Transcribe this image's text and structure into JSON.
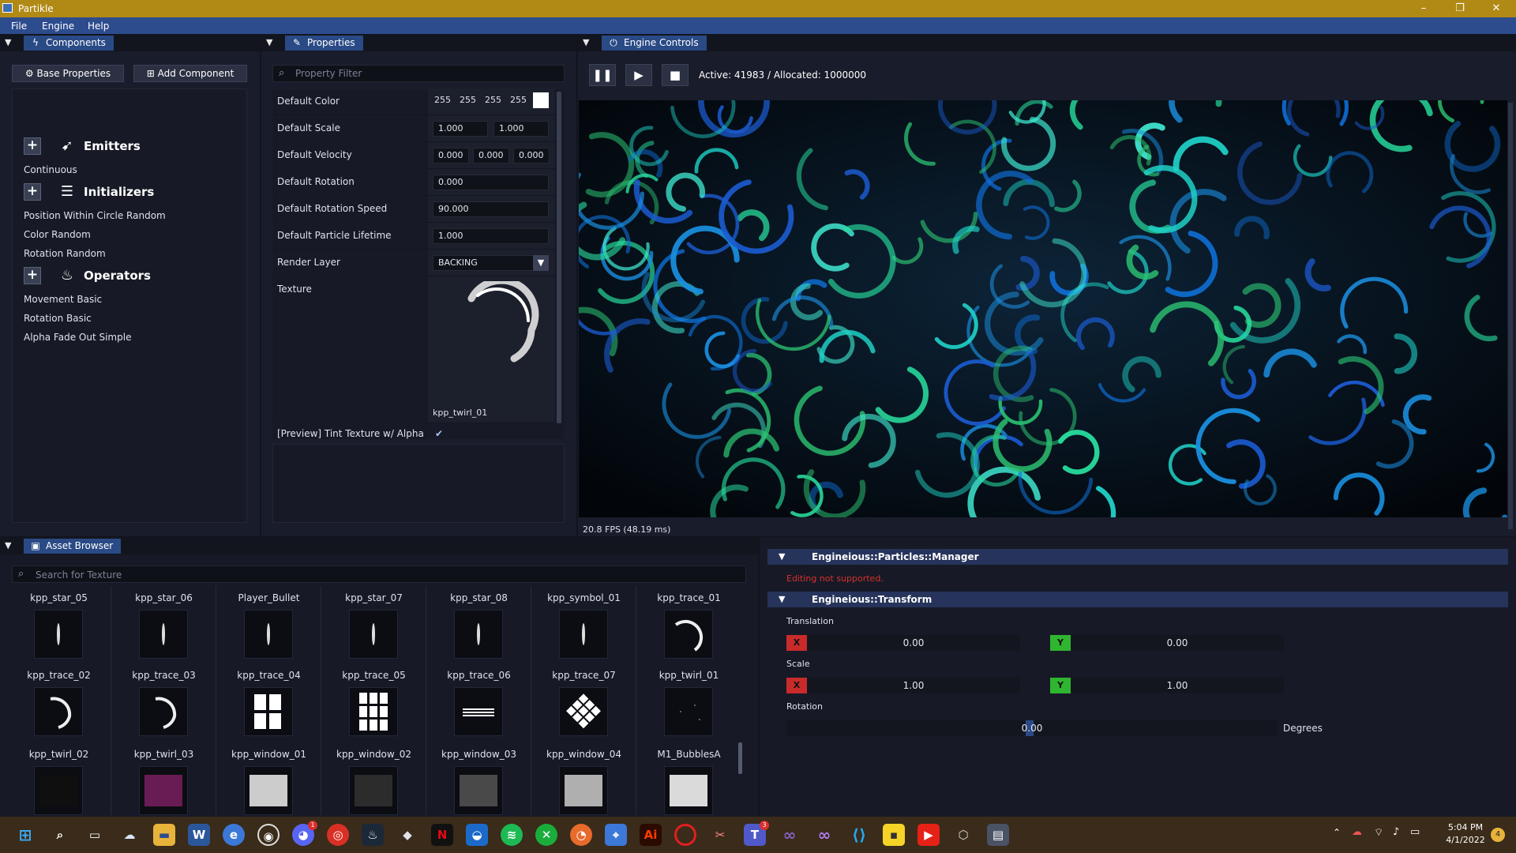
{
  "window": {
    "title": "Partikle",
    "minimize": "–",
    "maximize": "❐",
    "close": "✕"
  },
  "menu": [
    "File",
    "Engine",
    "Help"
  ],
  "components_panel": {
    "tab": "Components",
    "base_properties_button": "Base Properties",
    "add_component_button": "Add Component",
    "emitters": {
      "title": "Emitters",
      "items": [
        "Continuous"
      ]
    },
    "initializers": {
      "title": "Initializers",
      "items": [
        "Position Within Circle Random",
        "Color Random",
        "Rotation Random"
      ]
    },
    "operators": {
      "title": "Operators",
      "items": [
        "Movement Basic",
        "Rotation Basic",
        "Alpha Fade Out Simple"
      ]
    }
  },
  "properties_panel": {
    "tab": "Properties",
    "filter_placeholder": "Property Filter",
    "default_color": {
      "label": "Default Color",
      "r": "255",
      "g": "255",
      "b": "255",
      "a": "255",
      "swatch": "#ffffff"
    },
    "default_scale": {
      "label": "Default Scale",
      "x": "1.000",
      "y": "1.000"
    },
    "default_velocity": {
      "label": "Default Velocity",
      "x": "0.000",
      "y": "0.000",
      "z": "0.000"
    },
    "default_rotation": {
      "label": "Default Rotation",
      "value": "0.000"
    },
    "default_rotation_speed": {
      "label": "Default Rotation Speed",
      "value": "90.000"
    },
    "default_particle_lifetime": {
      "label": "Default Particle Lifetime",
      "value": "1.000"
    },
    "render_layer": {
      "label": "Render Layer",
      "value": "BACKING"
    },
    "texture": {
      "label": "Texture",
      "name": "kpp_twirl_01"
    },
    "tint_preview": {
      "label": "[Preview] Tint Texture w/ Alpha",
      "checked": true
    }
  },
  "engine_panel": {
    "tab": "Engine Controls",
    "status": "Active: 41983 / Allocated: 1000000",
    "fps": "20.8 FPS (48.19 ms)"
  },
  "asset_browser": {
    "tab": "Asset Browser",
    "search_placeholder": "Search for Texture",
    "top_labels": [
      "kpp_star_05",
      "kpp_star_06",
      "Player_Bullet",
      "kpp_star_07",
      "kpp_star_08",
      "kpp_symbol_01",
      "kpp_trace_01"
    ],
    "row1": [
      "kpp_trace_02",
      "kpp_trace_03",
      "kpp_trace_04",
      "kpp_trace_05",
      "kpp_trace_06",
      "kpp_trace_07",
      "kpp_twirl_01"
    ],
    "row2": [
      "kpp_twirl_02",
      "kpp_twirl_03",
      "kpp_window_01",
      "kpp_window_02",
      "kpp_window_03",
      "kpp_window_04",
      "M1_BubblesA"
    ]
  },
  "inspector": {
    "manager": {
      "title": "Engineious::Particles::Manager",
      "message": "Editing not supported."
    },
    "transform": {
      "title": "Engineious::Transform",
      "translation": {
        "label": "Translation",
        "x": "0.00",
        "y": "0.00"
      },
      "scale": {
        "label": "Scale",
        "x": "1.00",
        "y": "1.00"
      },
      "rotation": {
        "label": "Rotation",
        "value": "0.00",
        "unit": "Degrees"
      },
      "x_tag": "X",
      "y_tag": "Y"
    }
  },
  "taskbar": {
    "time": "5:04 PM",
    "date": "4/1/2022",
    "notifications": "4",
    "discord_badge": "1",
    "teams_badge": "3"
  },
  "colors": {
    "accent": "#2a4a86",
    "titlebar": "#b18a16",
    "x_axis": "#c92a2a",
    "y_axis": "#2fb52f",
    "error": "#d9302c"
  }
}
